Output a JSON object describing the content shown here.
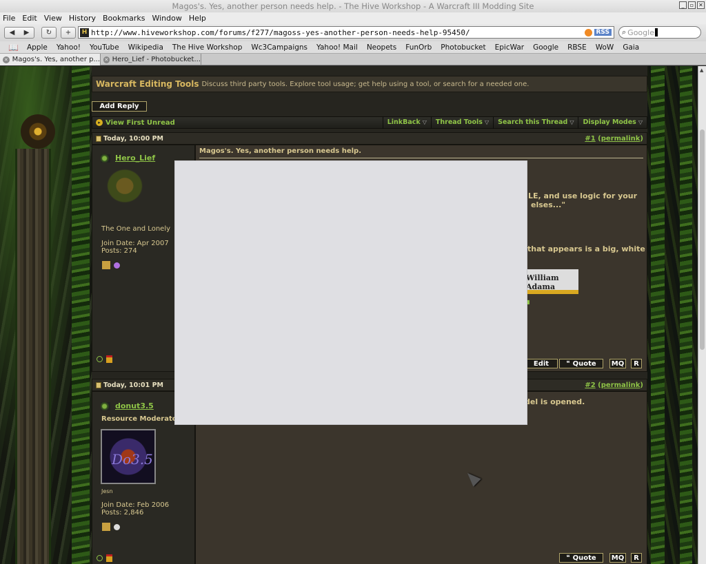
{
  "window": {
    "title": "Magos's. Yes, another person needs help. - The Hive Workshop - A Warcraft III Modding Site",
    "controls": [
      "_",
      "▫",
      "✕"
    ]
  },
  "menu": [
    "File",
    "Edit",
    "View",
    "History",
    "Bookmarks",
    "Window",
    "Help"
  ],
  "nav": {
    "back": "◀",
    "forward": "▶",
    "reload": "↻",
    "new_tab": "+",
    "site_icon": "H",
    "url": "http://www.hiveworkshop.com/forums/f277/magoss-yes-another-person-needs-help-95450/",
    "rss": "RSS",
    "search_placeholder": "Google"
  },
  "bookmarks": [
    "Apple",
    "Yahoo!",
    "YouTube",
    "Wikipedia",
    "The Hive Workshop",
    "Wc3Campaigns",
    "Yahoo! Mail",
    "Neopets",
    "FunOrb",
    "Photobucket",
    "EpicWar",
    "Google",
    "RBSE",
    "WoW",
    "Gaia"
  ],
  "tabs": [
    {
      "label": "Magos's. Yes, another p...",
      "active": true
    },
    {
      "label": "Hero_Lief - Photobucket...",
      "active": false
    }
  ],
  "forum": {
    "name": "Warcraft Editing Tools",
    "description": "Discuss third party tools. Explore tool usage; get help using a tool, or search for a needed one.",
    "add_reply": "Add Reply",
    "view_first_unread": "View First Unread",
    "tools": [
      "LinkBack",
      "Thread Tools",
      "Search this Thread",
      "Display Modes"
    ]
  },
  "posts": [
    {
      "date": "Today, 10:00 PM",
      "num": "#1",
      "permalink": "permalink",
      "username": "Hero_Lief",
      "user_title": "The One and Lonely",
      "join_date": "Join Date: Apr 2007",
      "posts": "Posts: 274",
      "title": "Magos's. Yes, another person needs help.",
      "text_lines": [
        "LE, and use logic for your",
        "elses...\"",
        "that appears is a big, white"
      ],
      "signature": "William Adama",
      "buttons": {
        "edit": "Edit",
        "quote": "Quote",
        "mq": "MQ",
        "r": "R"
      }
    },
    {
      "date": "Today, 10:01 PM",
      "num": "#2",
      "permalink": "permalink",
      "username": "donut3.5",
      "user_title": "Resource Moderator",
      "avatar_text": "Do3.5",
      "status_text": "Jesn",
      "join_date": "Join Date: Feb 2006",
      "posts": "Posts: 2,846",
      "text_lines": [
        "del is opened."
      ],
      "buttons": {
        "quote": "Quote",
        "mq": "MQ",
        "r": "R"
      }
    }
  ],
  "colors": {
    "link_green": "#8fc447",
    "text_tan": "#d8c890",
    "header_gold": "#d8b860",
    "overlay_gray": "#dfdfe3"
  }
}
